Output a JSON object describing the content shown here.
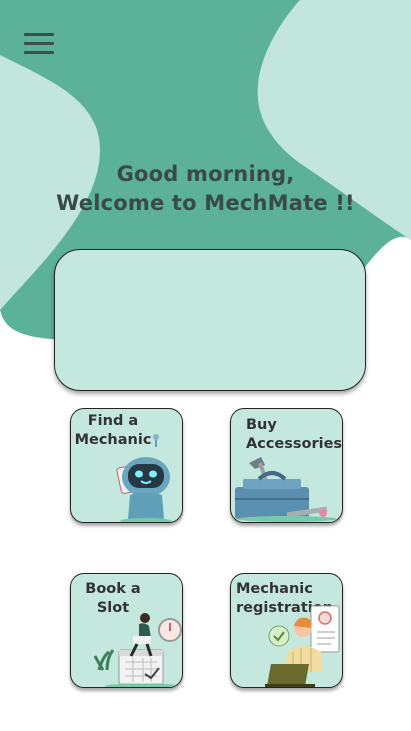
{
  "header": {
    "menu_icon": "hamburger-menu-icon",
    "greeting_line1": "Good morning,",
    "greeting_line2": "Welcome to MechMate !!"
  },
  "colors": {
    "primary": "#5bb298",
    "light": "#c2e5dc",
    "card": "#c4e8dd",
    "text": "#3a4a46"
  },
  "banner": {},
  "services": [
    {
      "line1": "Find a",
      "line2": "Mechanic",
      "icon": "robot-icon"
    },
    {
      "line1": "Buy",
      "line2": "Accessories",
      "icon": "toolbox-icon"
    },
    {
      "line1": "Book a",
      "line2": "Slot",
      "icon": "calendar-booking-icon"
    },
    {
      "line1": "Mechanic",
      "line2": "registration",
      "icon": "mechanic-registration-icon"
    }
  ]
}
